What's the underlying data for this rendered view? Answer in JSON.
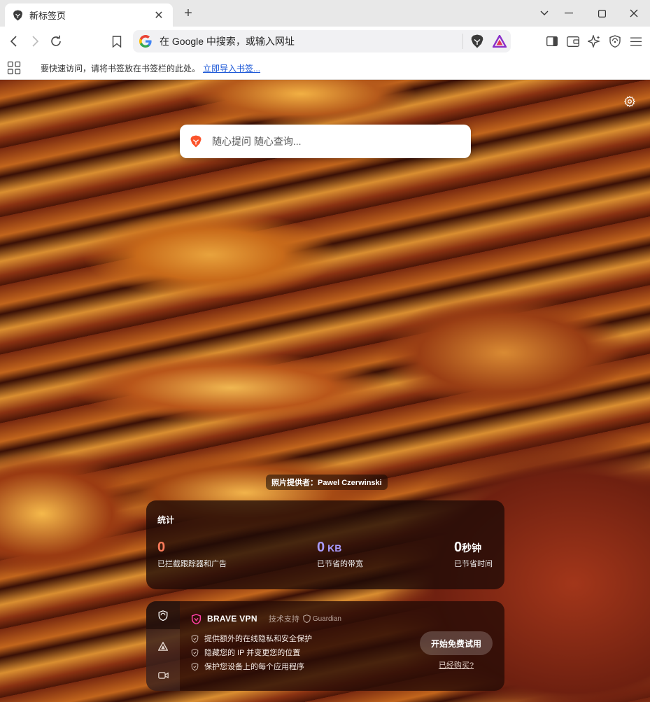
{
  "tab": {
    "title": "新标签页",
    "close": "✕",
    "new": "+"
  },
  "window": {
    "tabsearch": "⌄",
    "minimize": "—",
    "maximize": "☐",
    "close": "✕"
  },
  "omnibox": {
    "placeholder": "在 Google 中搜索，或输入网址"
  },
  "bookmarks": {
    "hint": "要快速访问，请将书签放在书签栏的此处。",
    "import_link": "立即导入书签..."
  },
  "ntp": {
    "search_placeholder": "随心提问 随心查询...",
    "photo_credit": "照片提供者：Pawel Czerwinski"
  },
  "stats": {
    "title": "统计",
    "items": [
      {
        "value": "0",
        "unit": "",
        "label": "已拦截跟踪器和广告",
        "color": "#ff7b5a"
      },
      {
        "value": "0",
        "unit": "KB",
        "label": "已节省的带宽",
        "color": "#a99cff"
      },
      {
        "value": "0",
        "unit": "秒钟",
        "label": "已节省时间",
        "color": "#ffffff"
      }
    ]
  },
  "vpn": {
    "title": "BRAVE VPN",
    "powered_by": "技术支持",
    "partner": "Guardian",
    "features": [
      "提供额外的在线隐私和安全保护",
      "隐藏您的 IP 并变更您的位置",
      "保护您设备上的每个应用程序"
    ],
    "cta": "开始免费试用",
    "already_bought": "已经购买?"
  },
  "colors": {
    "brave_orange": "#fb542b",
    "accent_link": "#1a56d6"
  }
}
